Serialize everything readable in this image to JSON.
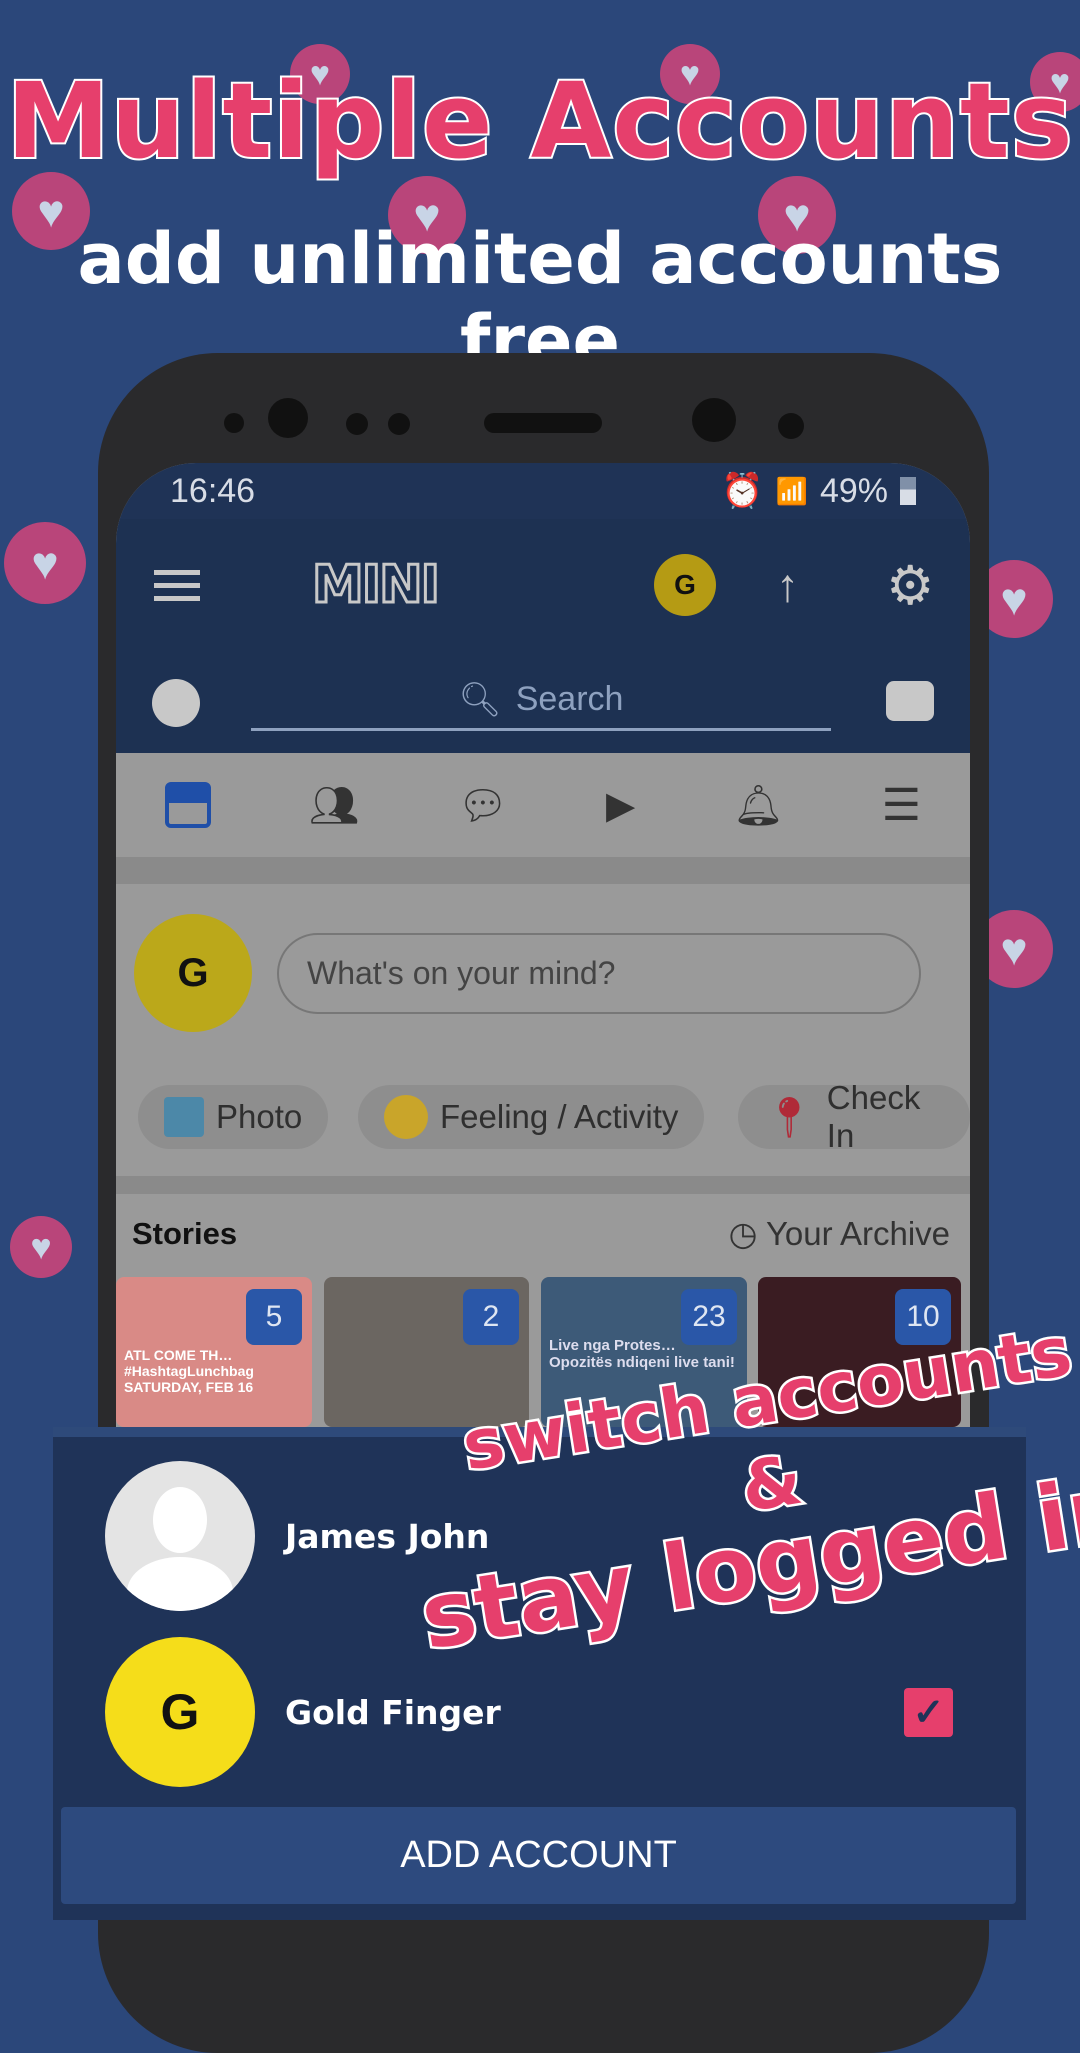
{
  "promo": {
    "title": "Multiple Accounts",
    "subtitle": "add unlimited accounts free",
    "overlay_line1": "switch accounts",
    "overlay_line2": "&",
    "overlay_line3": "stay logged in"
  },
  "status_bar": {
    "time": "16:46",
    "battery": "49%",
    "icons": [
      "alarm-icon",
      "wifi-icon",
      "signal-icon",
      "battery-icon"
    ]
  },
  "app_bar": {
    "logo": "MINI",
    "profile_avatar_initial": "G",
    "icons": [
      "menu-icon",
      "arrow-up-icon",
      "gear-icon"
    ]
  },
  "search": {
    "placeholder": "Search"
  },
  "tabs": [
    "news-feed-icon",
    "friends-icon",
    "messenger-icon",
    "watch-icon",
    "bell-icon",
    "menu-icon"
  ],
  "composer": {
    "placeholder": "What's on your mind?",
    "avatar_initial": "G",
    "avatar_caption": "Gold Finger",
    "chips": [
      {
        "label": "Photo",
        "icon": "photo-icon"
      },
      {
        "label": "Feeling / Activity",
        "icon": "smiley-icon"
      },
      {
        "label": "Check In",
        "icon": "location-pin-icon"
      }
    ]
  },
  "stories": {
    "title": "Stories",
    "archive_label": "Your Archive",
    "cards": [
      {
        "count": "5",
        "text": "ATL COME TH… #HashtagLunchbag SATURDAY, FEB 16",
        "color": "#d98a86"
      },
      {
        "count": "2",
        "text": "",
        "color": "#6b6661"
      },
      {
        "count": "23",
        "text": "Live nga Protes… Opozitës ndiqeni live tani!",
        "color": "#3d5a78"
      },
      {
        "count": "10",
        "text": "",
        "color": "#3a1c22"
      }
    ]
  },
  "accounts": [
    {
      "name": "James John",
      "avatar": "default-person",
      "selected": false
    },
    {
      "name": "Gold Finger",
      "avatar": "G",
      "avatar_caption": "Gold Finger",
      "selected": true
    }
  ],
  "add_account_label": "ADD ACCOUNT",
  "colors": {
    "accent_pink": "#e63f6c",
    "background": "#2b477a",
    "sheet": "#1f3358",
    "avatar_yellow": "#f5dd1a"
  }
}
